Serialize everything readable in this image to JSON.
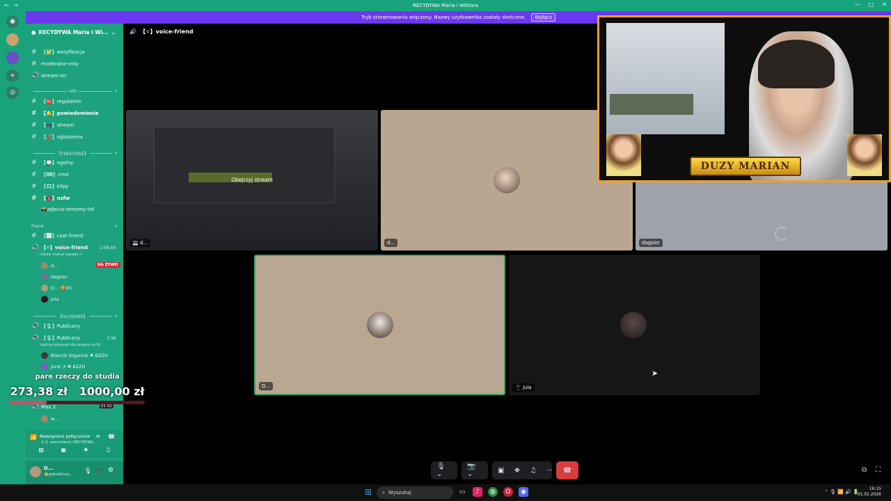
{
  "window": {
    "title": "RECYDYWA Maria i Wiktora",
    "nav": "← →",
    "controls": [
      "—",
      "□",
      "✕"
    ]
  },
  "banner": {
    "text": "Tryb streamowania włączony. Nazwy użytkownika zostały skrócone.",
    "button": "Wyłącz"
  },
  "server": {
    "name": "RECYDYWA Maria i Wi...",
    "channels_top": [
      {
        "prefix": "#",
        "name": "【✅】weryfikacja"
      },
      {
        "prefix": "#",
        "name": "moderator-only"
      },
      {
        "prefix": "🔊",
        "name": "stream-on"
      }
    ],
    "cat_info": "info",
    "channels_info": [
      {
        "prefix": "#",
        "name": "【⛔】regulamin",
        "bold": false
      },
      {
        "prefix": "#",
        "name": "【🔔】powiadomienia",
        "bold": true
      },
      {
        "prefix": "#",
        "name": "【📺】stream",
        "bold": false
      },
      {
        "prefix": "#",
        "name": "【📣】ogloszenia",
        "bold": false
      }
    ],
    "cat_text": "【TEKSTOWE】",
    "channels_text": [
      {
        "prefix": "#",
        "name": "【💬】ogolny",
        "bold": false
      },
      {
        "prefix": "#",
        "name": "【⌨】cmd",
        "bold": false
      },
      {
        "prefix": "#",
        "name": "【🎞】klipy",
        "bold": false
      },
      {
        "prefix": "#",
        "name": "【🔞】nsfw",
        "bold": true
      },
      {
        "prefix": "",
        "name": "📸zdjecia-streamy-itd",
        "bold": false
      }
    ],
    "cat_friend": "friend",
    "channels_friend": [
      {
        "prefix": "#",
        "name": "【⬜】czat-friend",
        "bold": false
      },
      {
        "prefix": "🔊",
        "name": "【⚪】voice-friend",
        "bold": true
      }
    ],
    "voice_time": "1:08:50",
    "voice_status": "Ustaw status kanału ✏",
    "voice_users": [
      {
        "name": "d...",
        "tag": "NA ŻYWO"
      },
      {
        "name": "dagsior",
        "tag": ""
      },
      {
        "name": "D... 🍪kfc",
        "tag": ""
      },
      {
        "name": "jula",
        "tag": ""
      }
    ],
    "cat_voice": "【GŁOSOWE】",
    "channels_voice": [
      {
        "prefix": "🔊",
        "name": "【🎙】Publiczny"
      },
      {
        "prefix": "🔊",
        "name": "【🎙】Publiczny"
      }
    ],
    "pub_time": "7:36",
    "pub_status": "casting koleżanki dla jaspera na t9",
    "pub_users": [
      "Blancik Gigancik ☘ BZZH",
      "Juror 2 ☘ BZZH"
    ],
    "max_channel": "Max 2",
    "max_counts": "01  02",
    "max_user": "w..."
  },
  "donation": {
    "title": "pare rzeczy do studia",
    "current": "273,38 zł",
    "goal": "1000,00 zł",
    "progress": 0.2734
  },
  "voice_panel": {
    "status": "Nawiązano połączenie",
    "channel": "【⚪】voice-friend / RECYDYWA ..."
  },
  "user_panel": {
    "name": "D...",
    "sub": "👋gekosDuzy..."
  },
  "call": {
    "channel": "【⚪】voice-friend",
    "stream_button": "Obejrzyj stream",
    "tiles": [
      {
        "label": "💻 d...",
        "bg": "#2a2c30"
      },
      {
        "label": "d...",
        "bg": "#b9a690"
      },
      {
        "label": "dagsior",
        "bg": "#9fa1ab"
      },
      {
        "label": "D...",
        "bg": "#baa792"
      },
      {
        "label": "📱 jula",
        "bg": "#171616"
      }
    ]
  },
  "webcam": {
    "overlay_text": "DUZY MARIAN"
  },
  "controls": {
    "mic": "🎙 ⌄",
    "cam": "📷 ⌄",
    "share": "▣",
    "activities": "❖",
    "soundboard": "♫",
    "more": "···",
    "end": "☎"
  },
  "taskbar": {
    "search": "Wyszukaj",
    "time": "16:15",
    "date": "01.02.2026"
  },
  "colors": {
    "accent": "#19a37c",
    "banner": "#6b37f0",
    "live": "#d92e3d",
    "hangup": "#d83c3e",
    "cam_border": "#f5a020"
  }
}
